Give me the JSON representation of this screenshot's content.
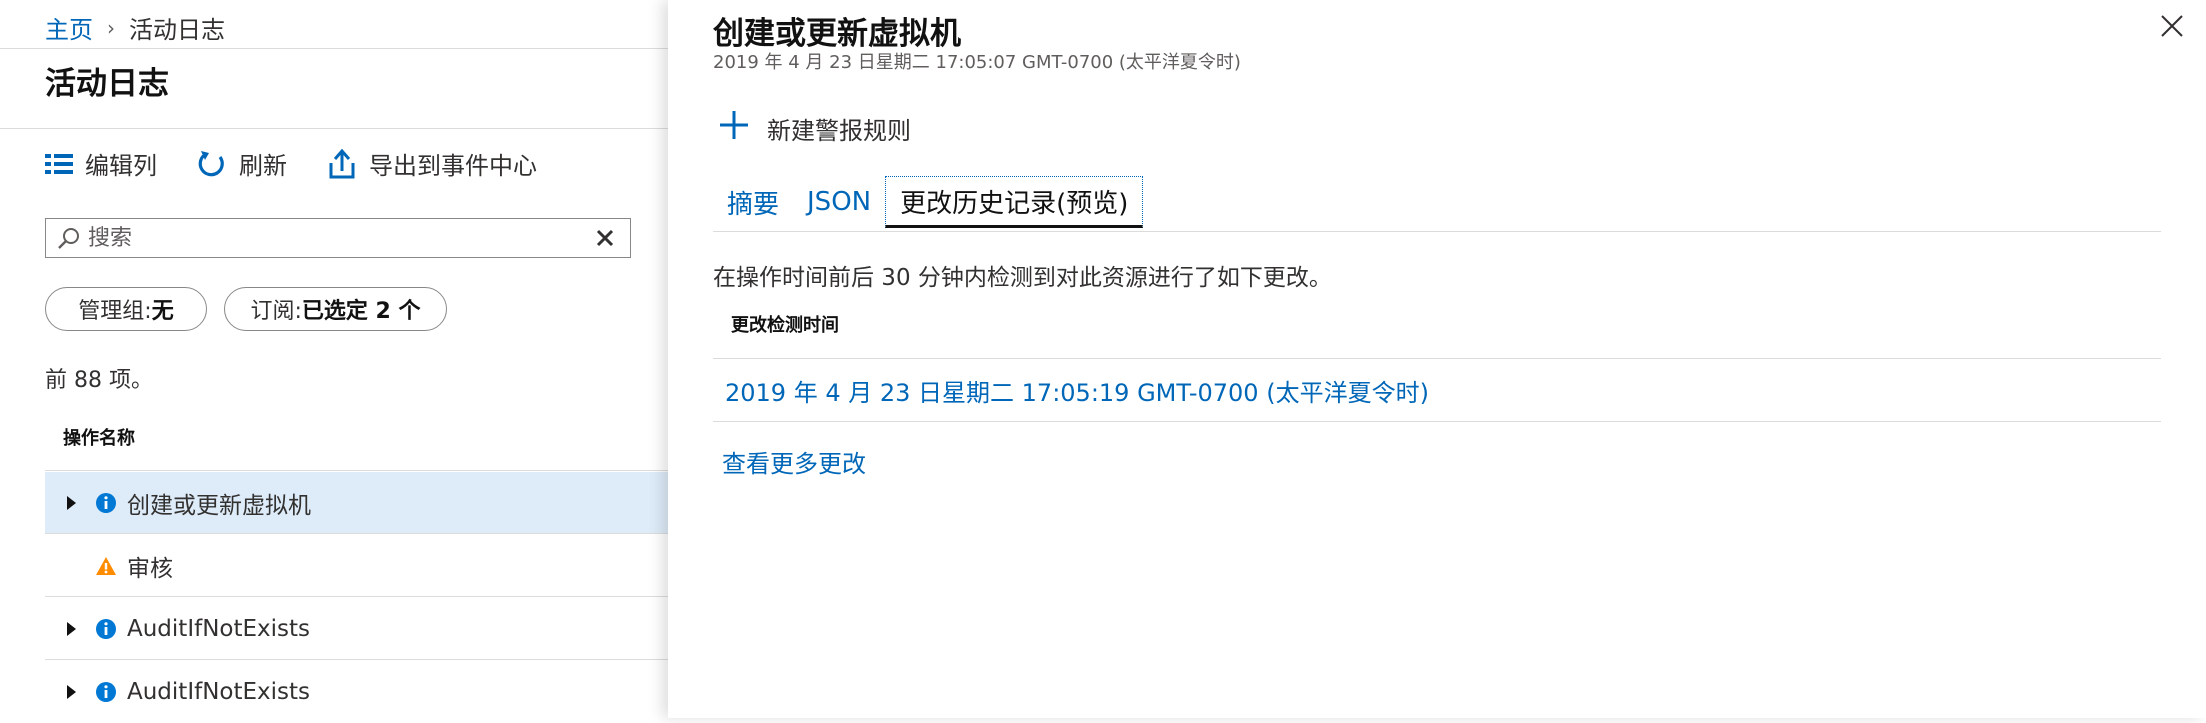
{
  "breadcrumb": {
    "home": "主页",
    "separator": "›",
    "current": "活动日志"
  },
  "page": {
    "title": "活动日志"
  },
  "toolbar": {
    "edit_columns": "编辑列",
    "refresh": "刷新",
    "export": "导出到事件中心"
  },
  "search": {
    "placeholder": "搜索",
    "value": ""
  },
  "filters": {
    "management_group": {
      "label": "管理组:",
      "value": "无"
    },
    "subscription": {
      "label": "订阅:",
      "value": "已选定 2 个"
    }
  },
  "result_count": "前 88 项。",
  "table": {
    "column_header": "操作名称",
    "rows": [
      {
        "name": "创建或更新虚拟机",
        "icon": "info-icon",
        "expandable": true,
        "selected": true
      },
      {
        "name": "审核",
        "icon": "warning-icon",
        "expandable": false,
        "selected": false
      },
      {
        "name": "AuditIfNotExists",
        "icon": "info-icon",
        "expandable": true,
        "selected": false
      },
      {
        "name": "AuditIfNotExists",
        "icon": "info-icon",
        "expandable": true,
        "selected": false
      }
    ]
  },
  "detail": {
    "title": "创建或更新虚拟机",
    "subtitle": "2019 年 4 月 23 日星期二 17:05:07 GMT-0700 (太平洋夏令时)",
    "new_alert": "新建警报规则",
    "tabs": [
      {
        "label": "摘要",
        "active": false
      },
      {
        "label": "JSON",
        "active": false
      },
      {
        "label": "更改历史记录(预览)",
        "active": true
      }
    ],
    "description": "在操作时间前后 30 分钟内检测到对此资源进行了如下更改。",
    "changes_header": "更改检测时间",
    "change_time": "2019 年 4 月 23 日星期二 17:05:19 GMT-0700 (太平洋夏令时)",
    "see_more": "查看更多更改"
  },
  "colors": {
    "accent": "#0067b8",
    "selected_row": "#deecf9",
    "info": "#0078d4",
    "warning": "#ff8c00"
  }
}
